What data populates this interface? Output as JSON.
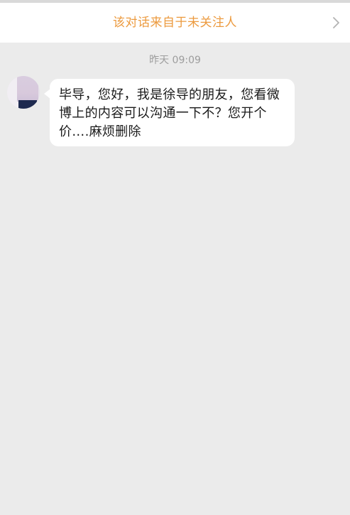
{
  "notice": {
    "text": "该对话来自于未关注人",
    "chevron_icon": "chevron-right-icon",
    "text_color": "#ec9a3e"
  },
  "conversation": {
    "timestamp": "昨天 09:09",
    "messages": [
      {
        "sender": "incoming",
        "avatar_icon": "avatar-image",
        "text": "毕导，您好，我是徐导的朋友，您看微博上的内容可以沟通一下不？您开个价….麻烦删除"
      }
    ]
  },
  "colors": {
    "background": "#ebebeb",
    "bubble": "#ffffff",
    "timestamp": "#9d9d9d"
  }
}
